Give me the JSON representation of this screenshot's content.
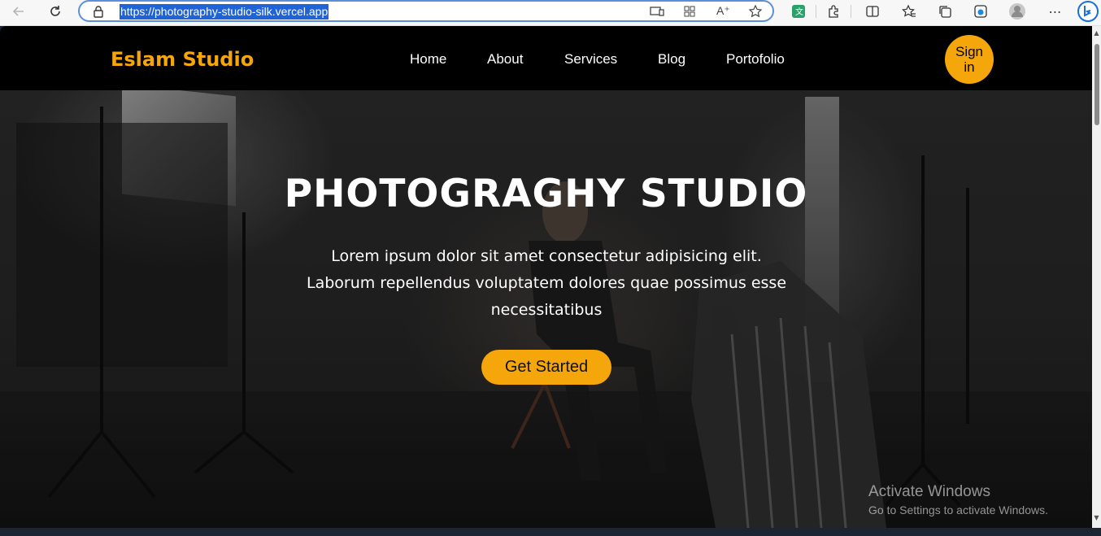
{
  "browser": {
    "url": "https://photography-studio-silk.vercel.app"
  },
  "nav": {
    "brand": "Eslam Studio",
    "links": [
      "Home",
      "About",
      "Services",
      "Blog",
      "Portofolio"
    ],
    "signin": "Sign in"
  },
  "hero": {
    "title": "PHOTOGRAGHY STUDIO",
    "description": "Lorem ipsum dolor sit amet consectetur adipisicing elit. Laborum repellendus voluptatem dolores quae possimus esse necessitatibus",
    "cta": "Get Started"
  },
  "watermark": {
    "line1": "Activate Windows",
    "line2": "Go to Settings to activate Windows."
  },
  "colors": {
    "accent": "#f5a60a",
    "nav_bg": "#000000"
  }
}
